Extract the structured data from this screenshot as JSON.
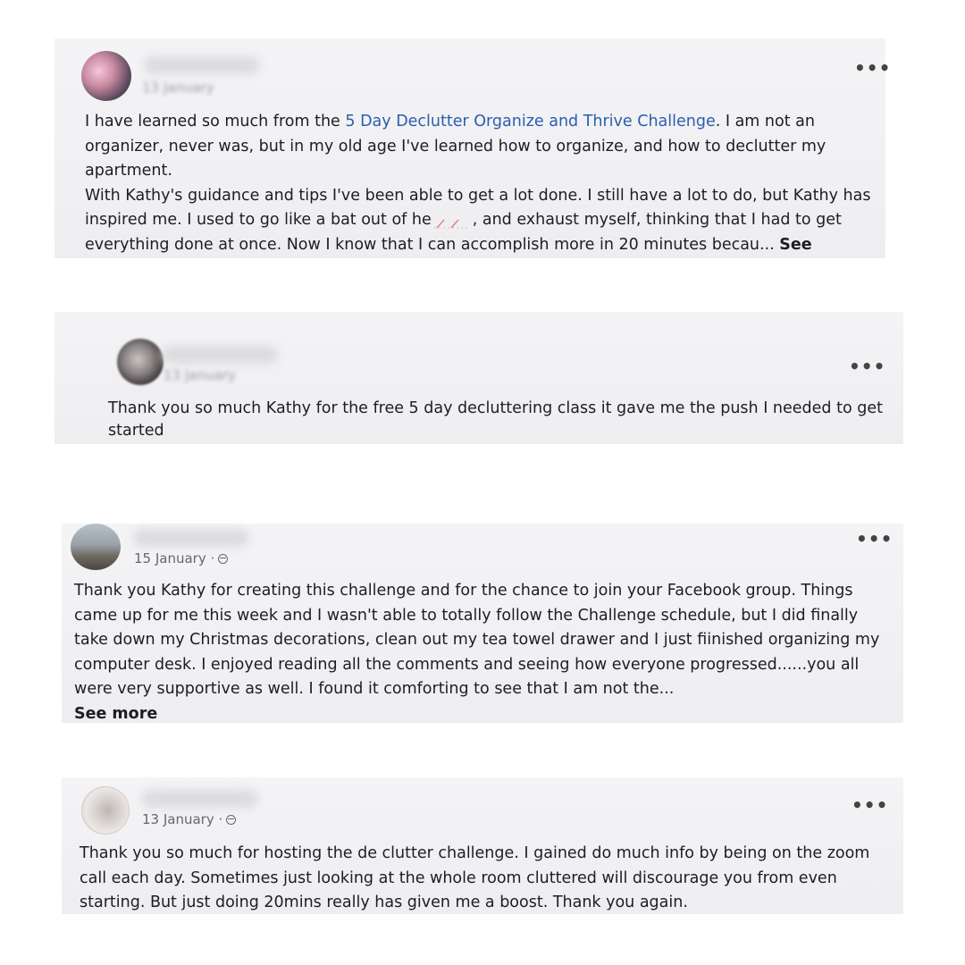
{
  "posts": [
    {
      "date": "13 January",
      "text_before_link": "I have learned so much from the ",
      "link": "5 Day Declutter Organize and Thrive Challenge",
      "text_after_link": ". I am not an organizer, never was, but in my old age I've learned how to organize, and how to declutter my apartment.",
      "paragraph2_before": "With Kathy's guidance and tips I've been able to get a lot done. I still have a lot to do, but Kathy has inspired me. I used to go like a bat out of he",
      "paragraph2_after": ", and exhaust myself, thinking that I had to get everything done at once. Now I know that I can accomplish more in 20 minutes becau...",
      "see_more": "See",
      "more_icon": "horizontal-ellipsis-icon"
    },
    {
      "date": "13 January",
      "text": "Thank you so much Kathy for the free 5 day decluttering class it gave me the push I needed to get started",
      "more_icon": "horizontal-ellipsis-icon"
    },
    {
      "date": "15 January ·",
      "text": "Thank you Kathy for creating this challenge and for the chance to join your Facebook group. Things came up for me this week and I wasn't able to totally follow the Challenge schedule, but I did finally take down my Christmas decorations, clean out my tea towel drawer and I just fiinished organizing my computer desk.  I enjoyed reading all the comments and seeing how everyone progressed......you all were very supportive as well.  I found it comforting to see that I am not the...",
      "see_more": "See more",
      "globe_icon": "globe-icon",
      "more_icon": "horizontal-ellipsis-icon"
    },
    {
      "date": "13 January ·",
      "text": "Thank you so much for hosting the de clutter challenge.  I gained do much info by being on the zoom call each day.  Sometimes just looking at the whole room cluttered will discourage you from even starting.  But just doing 20mins really has given me a boost. Thank you again.",
      "globe_icon": "globe-icon",
      "more_icon": "horizontal-ellipsis-icon"
    }
  ],
  "colors": {
    "link": "#2a5db0",
    "card_background": "#f0f0f2",
    "meta_text": "#65676b"
  }
}
